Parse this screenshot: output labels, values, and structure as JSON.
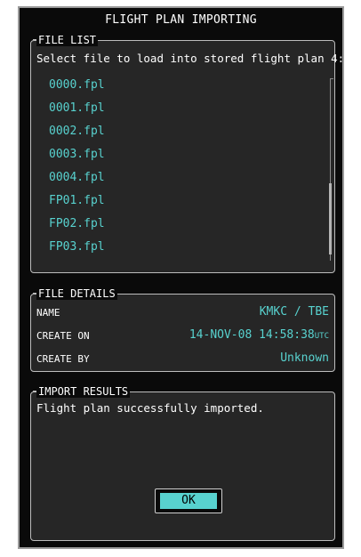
{
  "window": {
    "title": "FLIGHT PLAN IMPORTING"
  },
  "file_list": {
    "legend": "FILE LIST",
    "prompt": "Select file to load into stored flight plan 4:",
    "files": [
      "0000.fpl",
      "0001.fpl",
      "0002.fpl",
      "0003.fpl",
      "0004.fpl",
      "FP01.fpl",
      "FP02.fpl",
      "FP03.fpl"
    ]
  },
  "file_details": {
    "legend": "FILE DETAILS",
    "name_label": "NAME",
    "name_value": "KMKC / TBE",
    "create_on_label": "CREATE ON",
    "create_on_value": "14-NOV-08 14:58:38",
    "create_on_suffix": "UTC",
    "create_by_label": "CREATE BY",
    "create_by_value": "Unknown"
  },
  "import_results": {
    "legend": "IMPORT RESULTS",
    "message": "Flight plan successfully imported."
  },
  "ok_button": {
    "label": "OK"
  },
  "colors": {
    "accent": "#58d2cf",
    "background": "#0a0a0a",
    "panel": "#262626"
  }
}
